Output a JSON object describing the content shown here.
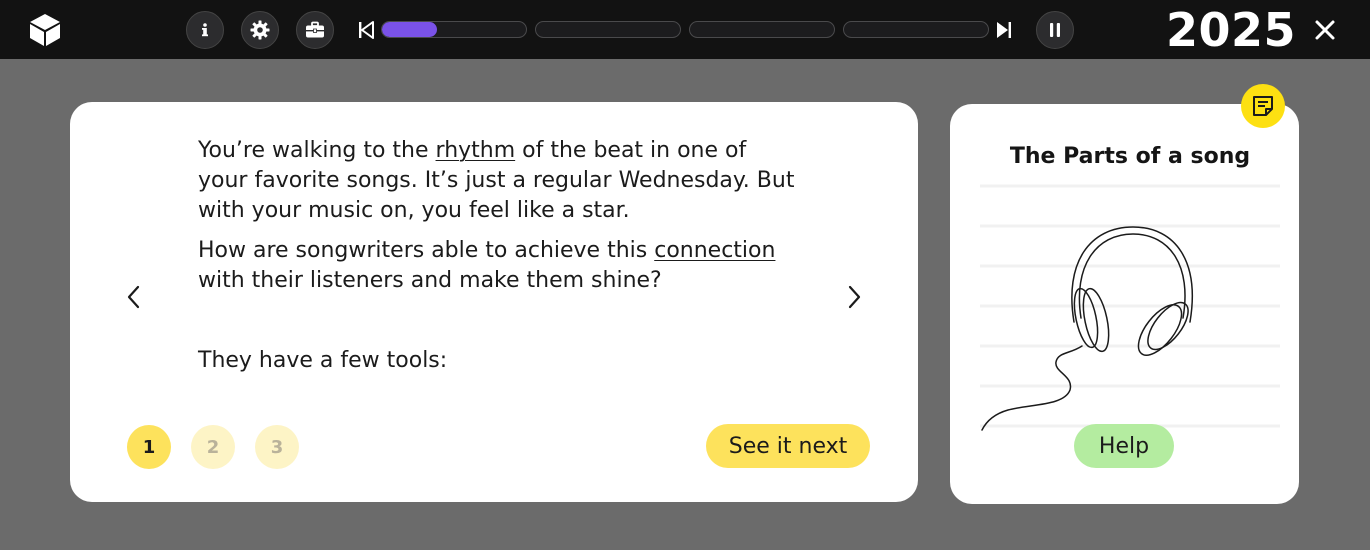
{
  "topbar": {
    "year": "2025",
    "icons": {
      "logo": "cube-icon",
      "info": "info-icon",
      "settings": "gear-icon",
      "toolkit": "briefcase-icon",
      "skip_back": "skip-back-icon",
      "skip_forward": "skip-forward-icon",
      "pause": "pause-icon",
      "close": "close-icon"
    },
    "progress": {
      "segments": 4,
      "current_segment": 1,
      "current_fill_fraction": 0.38
    },
    "accent_color": "#7a52e8"
  },
  "main": {
    "paragraph1": {
      "before": "You’re walking to the ",
      "link": "rhythm",
      "after": " of the beat in one of your favorite songs. It’s just a regular Wednesday. But with your music on, you feel like a star."
    },
    "paragraph2": {
      "before": "How are songwriters able to achieve this ",
      "link": "connection",
      "after": " with their listeners and make them shine?"
    },
    "tools_line": "They have a few tools:",
    "pages": [
      "1",
      "2",
      "3"
    ],
    "active_page": "1",
    "next_button": "See it next",
    "button_color": "#fde25c"
  },
  "side": {
    "title": "The Parts of a song",
    "help_button": "Help",
    "help_color": "#b4eca0",
    "image": "headphones-line-drawing",
    "badge_icon": "notes-icon"
  }
}
